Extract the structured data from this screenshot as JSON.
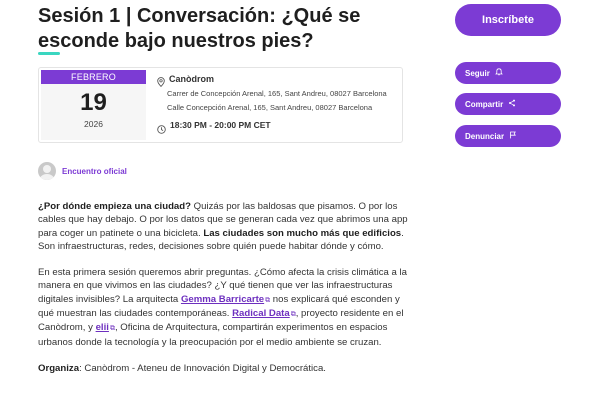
{
  "event": {
    "title": "Sesión 1 | Conversación: ¿Qué se esconde bajo nuestros pies?",
    "date": {
      "month": "FEBRERO",
      "day": "19",
      "year": "2026"
    },
    "location": {
      "name": "Canòdrom",
      "address_1": "Carrer de Concepción Arenal, 165, Sant Andreu, 08027 Barcelona",
      "address_2": "Calle Concepción Arenal, 165, Sant Andreu, 08027 Barcelona"
    },
    "time": "18:30 PM - 20:00 PM CET"
  },
  "organizer": {
    "label": "Encuentro oficial"
  },
  "description": {
    "p1": {
      "lead": "¿Por dónde empieza una ciudad?",
      "text1": " Quizás por las baldosas que pisamos. O por los cables que hay debajo. O por los datos que se generan cada vez que abrimos una app para coger un patinete o una bicicleta. ",
      "bold": "Las ciudades son mucho más que edificios",
      "text2": ". Son infraestructuras, redes, decisiones sobre quién puede habitar dónde y cómo."
    },
    "p2": {
      "text1": "En esta primera sesión queremos abrir preguntas. ¿Cómo afecta la crisis climática a la manera en que vivimos en las ciudades? ¿Y qué tienen que ver las infraestructuras digitales invisibles? La arquitecta ",
      "link1": "Gemma Barricarte",
      "text2": " nos explicará qué esconden y qué muestran las ciudades contemporáneas. ",
      "link2": "Radical Data",
      "text3": ", proyecto residente en el Canòdrom, y ",
      "link3": "elii",
      "text4": ", Oficina de Arquitectura, compartirán experimentos en espacios urbanos donde la tecnología y la preocupación por el medio ambiente se cruzan."
    },
    "p3": {
      "label": "Organiza",
      "text": ": Canòdrom - Ateneu de Innovación Digital y Democrática."
    }
  },
  "sidebar": {
    "register_label": "Inscríbete",
    "follow_label": "Seguir",
    "share_label": "Compartir",
    "report_label": "Denunciar"
  },
  "colors": {
    "accent": "#7c3bd4",
    "underline": "#3ad6c0"
  }
}
